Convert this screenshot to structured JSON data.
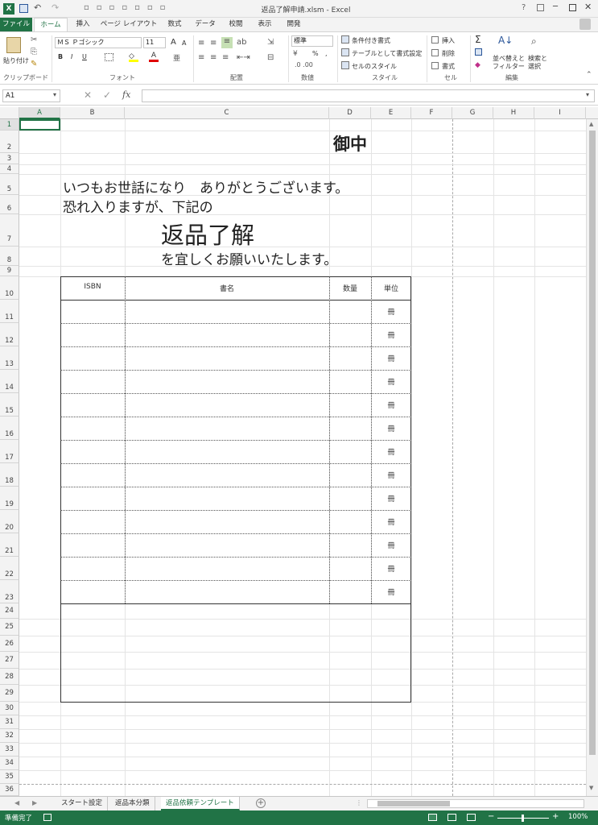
{
  "window": {
    "title": "返品了解申請.xlsm - Excel",
    "help": "?"
  },
  "tabs": [
    "ファイル",
    "ホーム",
    "挿入",
    "ページ レイアウト",
    "数式",
    "データ",
    "校閲",
    "表示",
    "開発"
  ],
  "ribbon": {
    "clipboard": {
      "paste": "貼り付け",
      "label": "クリップボード"
    },
    "font": {
      "name": "ＭＳ Ｐゴシック",
      "size": "11",
      "bold": "B",
      "italic": "I",
      "underline": "U",
      "grow": "A",
      "shrink": "A",
      "label": "フォント"
    },
    "alignment": {
      "label": "配置"
    },
    "number": {
      "format": "標準",
      "percent": "%",
      "comma": ",",
      "label": "数値"
    },
    "styles": {
      "conditional": "条件付き書式",
      "table": "テーブルとして書式設定",
      "cell": "セルのスタイル",
      "label": "スタイル"
    },
    "cells": {
      "insert": "挿入",
      "delete": "削除",
      "format": "書式",
      "label": "セル"
    },
    "editing": {
      "sum": "Σ",
      "sort": "並べ替えと フィルター",
      "find": "検索と 選択",
      "label": "編集"
    }
  },
  "formula_bar": {
    "name_box": "A1",
    "fx": "fx",
    "value": ""
  },
  "columns": [
    "A",
    "B",
    "C",
    "D",
    "E",
    "F",
    "G",
    "H",
    "I"
  ],
  "rows": [
    "1",
    "2",
    "3",
    "4",
    "5",
    "6",
    "7",
    "8",
    "9",
    "10",
    "11",
    "12",
    "13",
    "14",
    "15",
    "16",
    "17",
    "18",
    "19",
    "20",
    "21",
    "22",
    "23",
    "24",
    "25",
    "26",
    "27",
    "28",
    "29",
    "30",
    "31",
    "32",
    "33",
    "34",
    "35",
    "36"
  ],
  "sheet": {
    "addressee": "御中",
    "line1": "いつもお世話になり　ありがとうございます。",
    "line2": "恐れ入りますが、下記の",
    "heading": "返品了解",
    "line3": "を宜しくお願いいたします。",
    "table_headers": [
      "ISBN",
      "書名",
      "数量",
      "単位"
    ],
    "unit": "冊"
  },
  "sheet_tabs": [
    "スタート設定",
    "返品本分類",
    "返品依頼テンプレート"
  ],
  "active_sheet": "返品依頼テンプレート",
  "status": {
    "ready": "準備完了",
    "zoom": "100%"
  }
}
